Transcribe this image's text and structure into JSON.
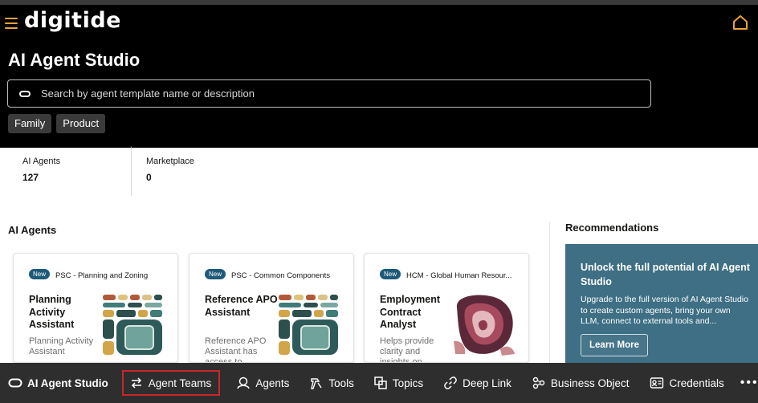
{
  "app": {
    "logo": "digitide",
    "title": "AI Agent Studio"
  },
  "search": {
    "placeholder": "Search by agent template name or description"
  },
  "filters": [
    "Family",
    "Product"
  ],
  "stats": [
    {
      "label": "AI Agents",
      "value": "127"
    },
    {
      "label": "Marketplace",
      "value": "0"
    }
  ],
  "sections": {
    "agents": "AI Agents",
    "recommendations": "Recommendations"
  },
  "cards": [
    {
      "badge": "New",
      "family": "PSC - Planning and Zoning",
      "name": "Planning Activity Assistant",
      "desc": "Planning Activity Assistant"
    },
    {
      "badge": "New",
      "family": "PSC - Common Components",
      "name": "Reference APO Assistant",
      "desc": "Reference APO Assistant has access to"
    },
    {
      "badge": "New",
      "family": "HCM - Global Human Resour...",
      "name": "Employment Contract Analyst",
      "desc": "Helps provide clarity and insights on"
    }
  ],
  "promo": {
    "title": "Unlock the full potential of AI Agent Studio",
    "body": "Upgrade to the full version of AI Agent Studio to create custom agents, bring your own LLM, connect to external tools and...",
    "button": "Learn More"
  },
  "nav": [
    {
      "label": "AI Agent Studio",
      "icon": "pill-icon"
    },
    {
      "label": "Agent Teams",
      "icon": "agent-teams-icon",
      "active": true
    },
    {
      "label": "Agents",
      "icon": "agent-icon"
    },
    {
      "label": "Tools",
      "icon": "tools-icon"
    },
    {
      "label": "Topics",
      "icon": "topics-icon"
    },
    {
      "label": "Deep Link",
      "icon": "link-icon"
    },
    {
      "label": "Business Object",
      "icon": "business-object-icon"
    },
    {
      "label": "Credentials",
      "icon": "credentials-icon"
    }
  ],
  "more": "•••",
  "colors": {
    "header_bg": "#000000",
    "accent_orange": "#e8a33a",
    "badge_blue": "#1d5a7a",
    "promo_bg": "#3e6f84",
    "bottom_bar": "#2e2e2e",
    "active_outline": "#c6282d"
  }
}
